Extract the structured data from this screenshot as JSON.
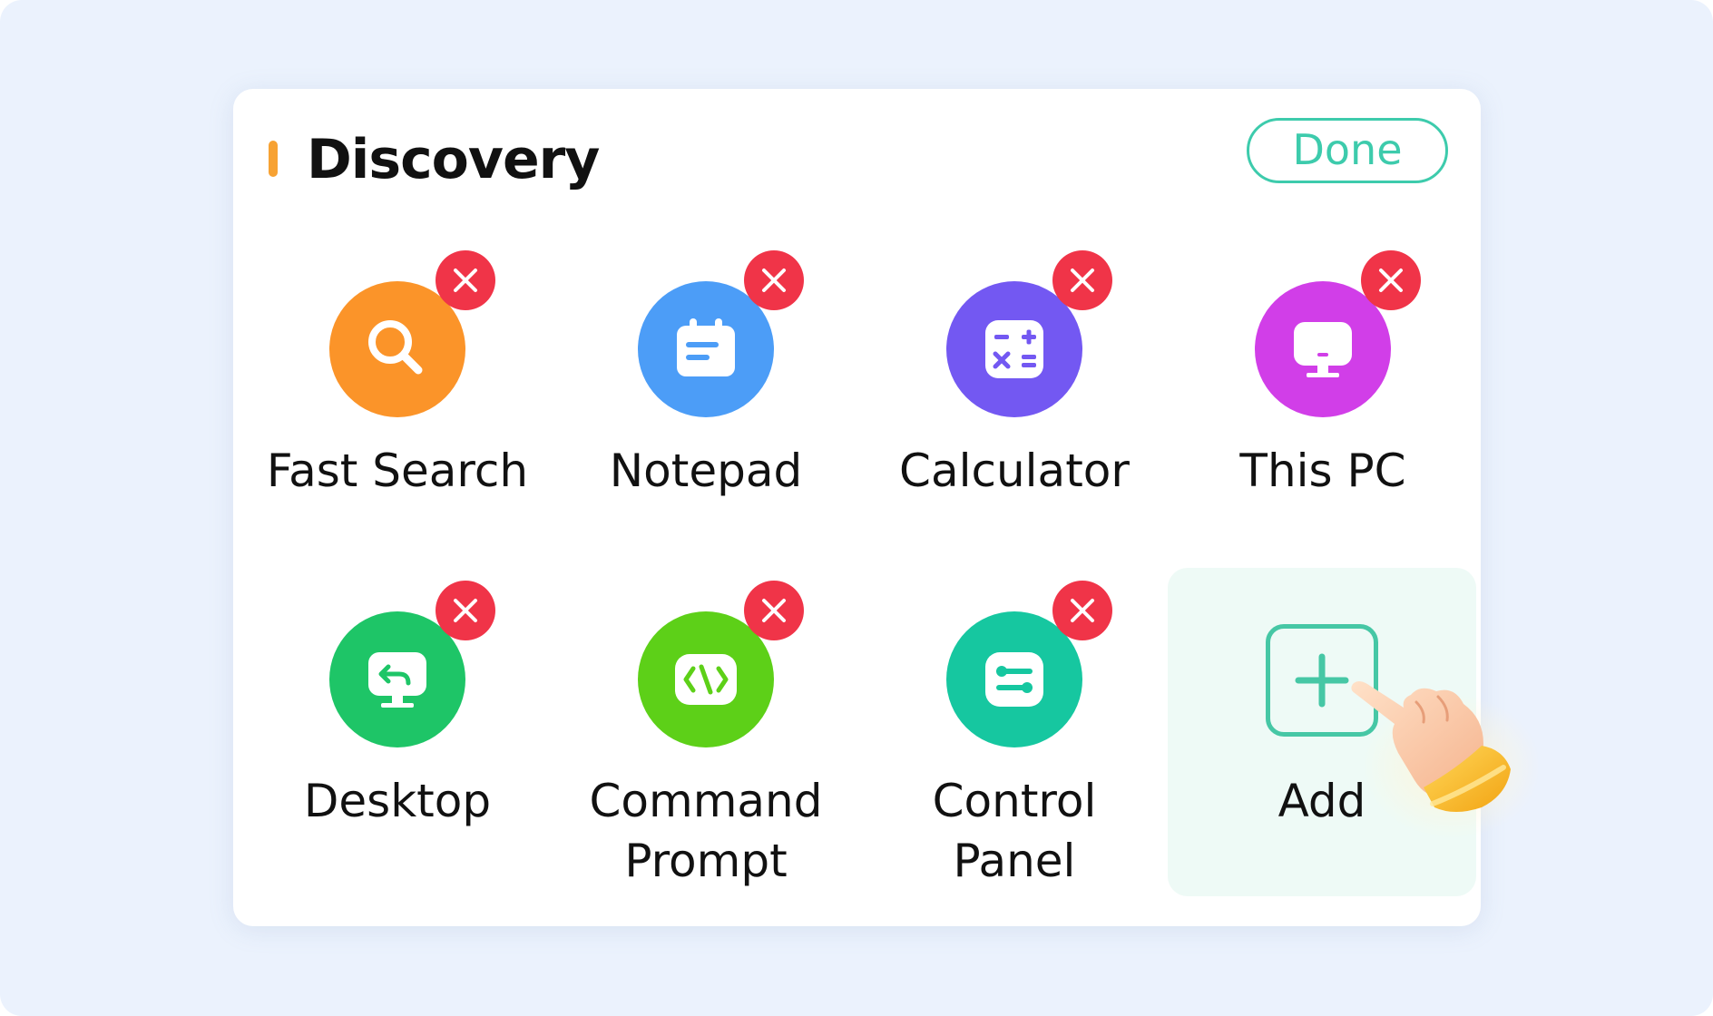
{
  "header": {
    "title": "Discovery",
    "done_label": "Done"
  },
  "colors": {
    "accent": "#3dcbac",
    "title_marker": "#f7a233",
    "remove_badge": "#f03448"
  },
  "tools": [
    {
      "label": "Fast Search",
      "icon": "search-icon",
      "color": "#fb9429"
    },
    {
      "label": "Notepad",
      "icon": "notepad-icon",
      "color": "#4c9df7"
    },
    {
      "label": "Calculator",
      "icon": "calculator-icon",
      "color": "#7358f2"
    },
    {
      "label": "This PC",
      "icon": "monitor-icon",
      "color": "#d13ee8"
    },
    {
      "label": "Desktop",
      "icon": "desktop-icon",
      "color": "#1ec567"
    },
    {
      "label": "Command\nPrompt",
      "icon": "code-icon",
      "color": "#5dd018"
    },
    {
      "label": "Control\nPanel",
      "icon": "control-panel-icon",
      "color": "#16c7a0"
    }
  ],
  "add": {
    "label": "Add",
    "icon": "plus-icon"
  },
  "cursor": {
    "icon": "pointing-hand-icon"
  }
}
